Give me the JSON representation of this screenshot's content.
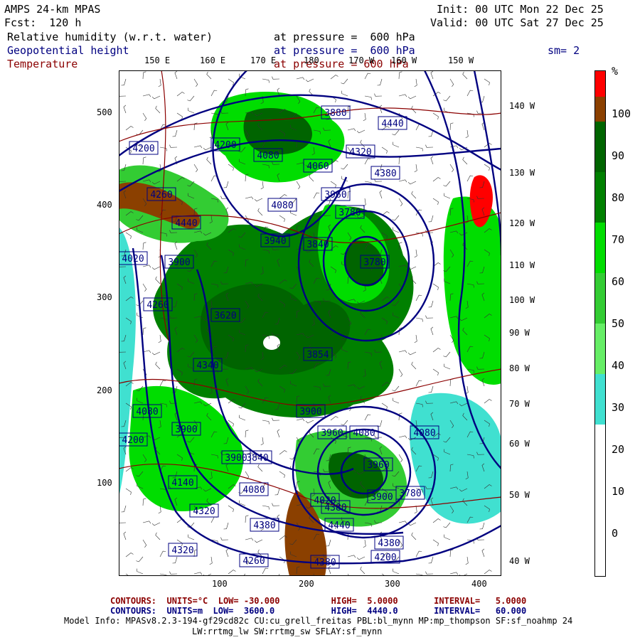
{
  "header": {
    "title": "AMPS 24-km MPAS",
    "forecast": "Fcst:  120 h",
    "init": "Init: 00 UTC Mon 22 Dec 25",
    "valid": "Valid: 00 UTC Sat 27 Dec 25",
    "fields": [
      {
        "name": "Relative humidity (w.r.t. water)",
        "level": "at pressure =  600 hPa",
        "color": "#000000"
      },
      {
        "name": "Geopotential height",
        "level": "at pressure =  600 hPa",
        "color": "#000080"
      },
      {
        "name": "Temperature",
        "level": "at pressure = 600 hPa",
        "color": "#8b0000"
      }
    ],
    "smoothing": "sm= 2"
  },
  "axes": {
    "top_lon": [
      "150 E",
      "160 E",
      "170 E",
      "180",
      "170 W",
      "160 W",
      "150 W"
    ],
    "right_lon": [
      "140 W",
      "130 W",
      "120 W",
      "110 W",
      "100 W",
      "90 W",
      "80 W",
      "70 W",
      "60 W",
      "50 W",
      "40 W"
    ],
    "left_y": [
      "500",
      "400",
      "300",
      "200",
      "100"
    ],
    "bottom_x": [
      "100",
      "200",
      "300",
      "400"
    ]
  },
  "colorbar": {
    "unit": "%",
    "labels": [
      "100",
      "90",
      "80",
      "70",
      "60",
      "50",
      "40",
      "30",
      "20",
      "10",
      "0"
    ],
    "bands": [
      {
        "from": 95,
        "to": 100,
        "color": "#ff0000"
      },
      {
        "from": 90,
        "to": 95,
        "color": "#8b4000"
      },
      {
        "from": 80,
        "to": 90,
        "color": "#006400"
      },
      {
        "from": 70,
        "to": 80,
        "color": "#008000"
      },
      {
        "from": 60,
        "to": 70,
        "color": "#00dd00"
      },
      {
        "from": 50,
        "to": 60,
        "color": "#33cc33"
      },
      {
        "from": 40,
        "to": 50,
        "color": "#66ee66"
      },
      {
        "from": 30,
        "to": 40,
        "color": "#40e0d0"
      },
      {
        "from": 0,
        "to": 30,
        "color": "#ffffff"
      }
    ]
  },
  "height_labels": [
    "4200",
    "3880",
    "4440",
    "4320",
    "4200",
    "4080",
    "4060",
    "4380",
    "3960",
    "4260",
    "4440",
    "4080",
    "3780",
    "3940",
    "3840",
    "3780",
    "4020",
    "3900",
    "4260",
    "3620",
    "3854",
    "3900",
    "3960",
    "4080",
    "3900",
    "4200",
    "3900",
    "3900",
    "3780",
    "3960",
    "4080",
    "3840",
    "4140",
    "4020",
    "4320",
    "4080",
    "4380",
    "4440",
    "4380",
    "4320",
    "4380",
    "4260",
    "4380",
    "4200",
    "4340",
    "4080"
  ],
  "footer": {
    "temp_line": "CONTOURS:  UNITS=°C  LOW= -30.000          HIGH=  5.0000       INTERVAL=   5.0000",
    "height_line": "CONTOURS:  UNITS=m  LOW=  3600.0           HIGH=  4440.0       INTERVAL=   60.000",
    "model_info_1": "Model Info: MPASv8.2.3-194-gf29cd82c CU:cu_grell_freitas PBL:bl_mynn MP:mp_thompson SF:sf_noahmp 24",
    "model_info_2": "LW:rrtmg_lw SW:rrtmg_sw SFLAY:sf_mynn"
  }
}
